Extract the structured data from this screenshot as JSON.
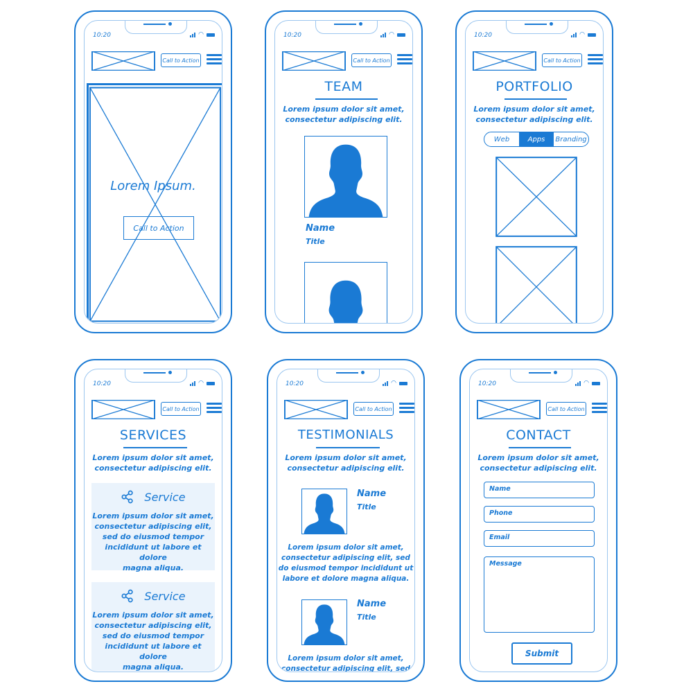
{
  "common": {
    "time": "10:20",
    "cta_label": "Call to Action",
    "subtitle_line1": "Lorem ipsum dolor sit amet,",
    "subtitle_line2": "consectetur adipiscing elit."
  },
  "colors": {
    "accent": "#1a7ad4",
    "light_border": "#9cc6ef",
    "card_bg": "#eaf3fc"
  },
  "home": {
    "hero_title": "Lorem Ipsum.",
    "hero_button": "Call to Action"
  },
  "team": {
    "heading": "TEAM",
    "members": [
      {
        "name": "Name",
        "title": "Title"
      }
    ]
  },
  "portfolio": {
    "heading": "PORTFOLIO",
    "filters": [
      "Web",
      "Apps",
      "Branding"
    ],
    "active_filter": "Apps"
  },
  "services": {
    "heading": "SERVICES",
    "items": [
      {
        "label": "Service",
        "icon": "share-icon",
        "text": [
          "Lorem ipsum dolor sit amet,",
          "consectetur adipiscing elit,",
          "sed do eiusmod tempor",
          "incididunt ut labore et dolore",
          "magna aliqua."
        ]
      },
      {
        "label": "Service",
        "icon": "share-icon",
        "text": [
          "Lorem ipsum dolor sit amet,",
          "consectetur adipiscing elit,",
          "sed do eiusmod tempor",
          "incididunt ut labore et dolore",
          "magna aliqua."
        ]
      }
    ]
  },
  "testimonials": {
    "heading": "TESTIMONIALS",
    "items": [
      {
        "name": "Name",
        "title": "Title",
        "quote": [
          "Lorem ipsum dolor sit amet,",
          "consectetur adipiscing elit, sed",
          "do eiusmod tempor incididunt ut",
          "labore et dolore magna aliqua."
        ]
      },
      {
        "name": "Name",
        "title": "Title",
        "quote": [
          "Lorem ipsum dolor sit amet,",
          "consectetur adipiscing elit, sed"
        ]
      }
    ]
  },
  "contact": {
    "heading": "CONTACT",
    "fields": {
      "name": "Name",
      "phone": "Phone",
      "email": "Email",
      "message": "Message"
    },
    "submit": "Submit"
  }
}
